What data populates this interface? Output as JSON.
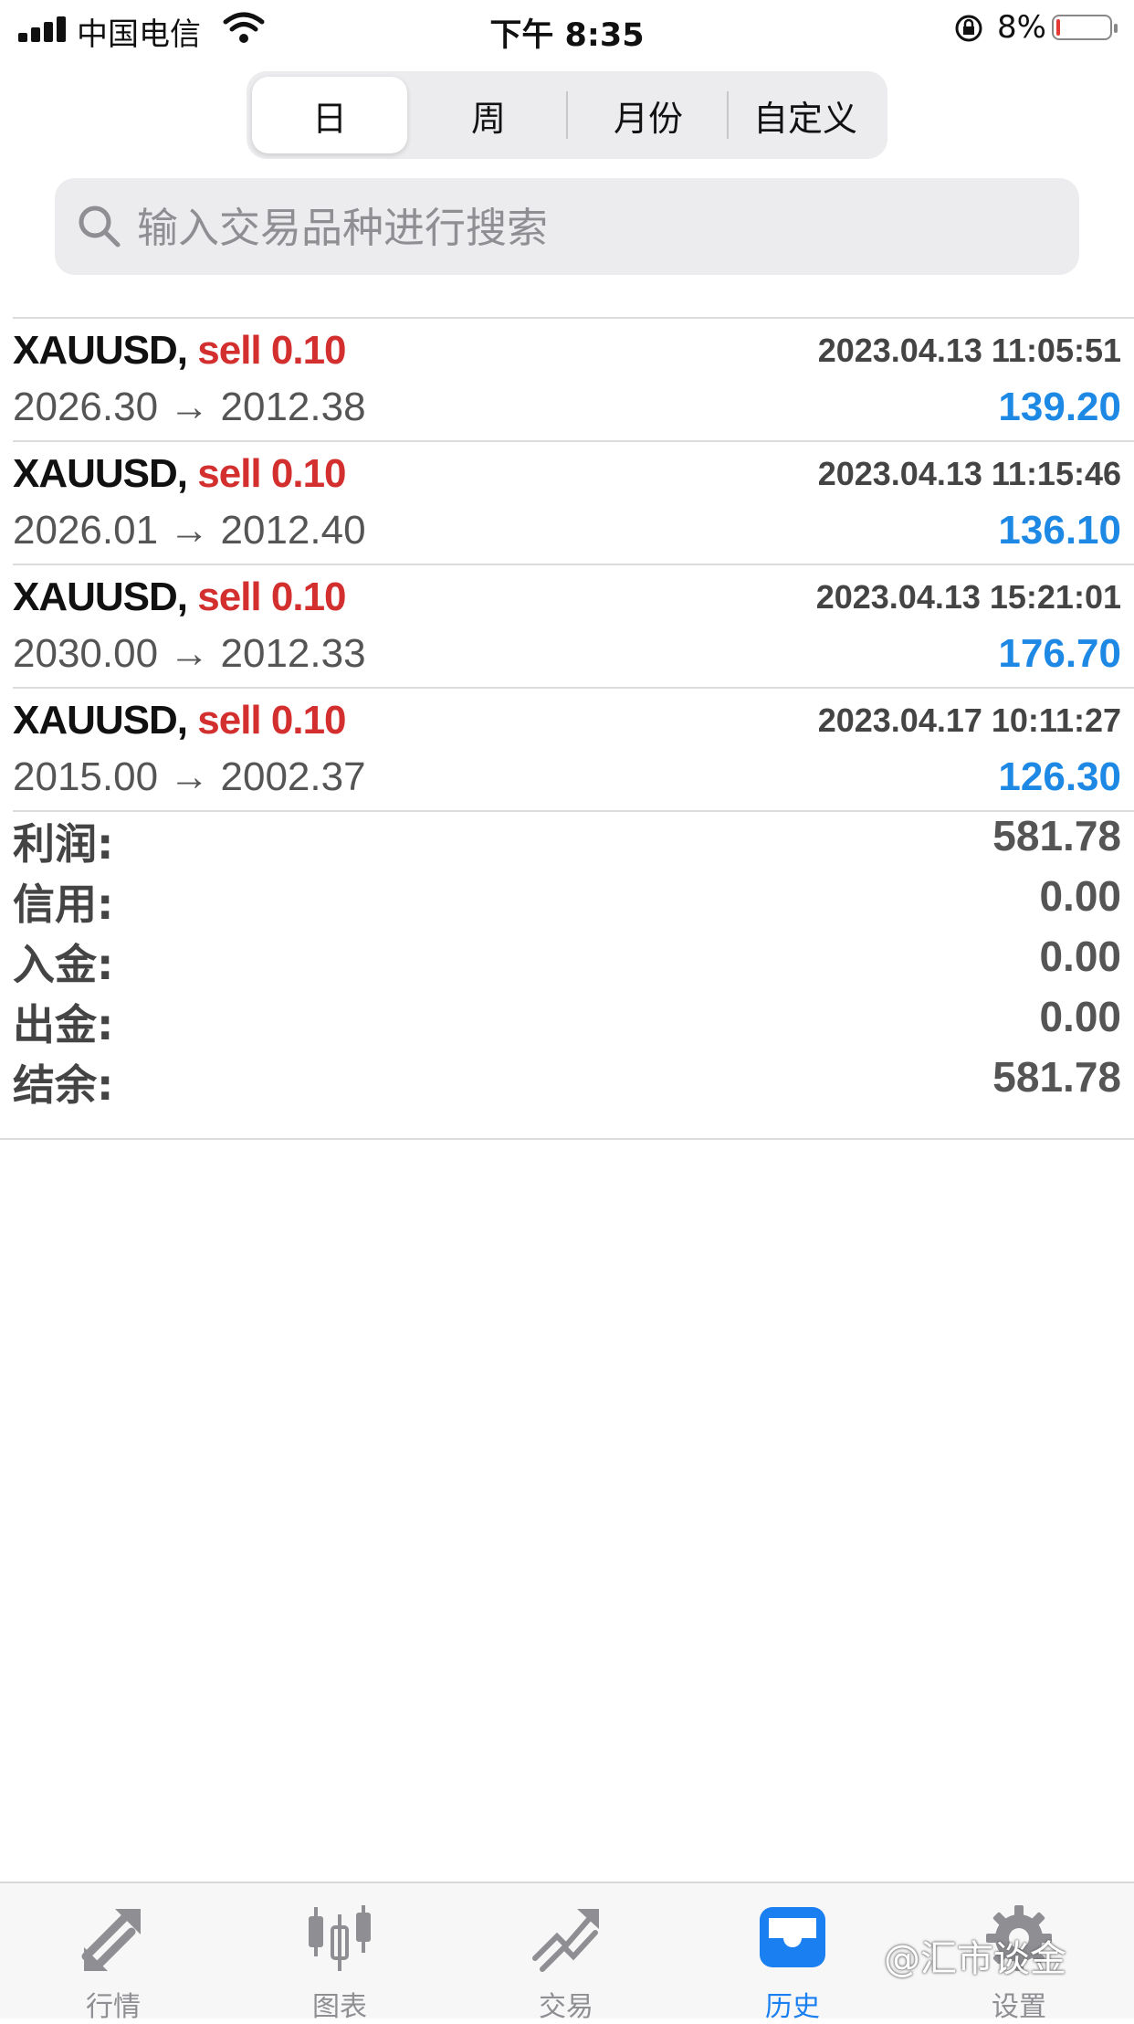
{
  "status_bar": {
    "carrier": "中国电信",
    "time": "下午 8:35",
    "battery": "8%",
    "battery_level": 0.08
  },
  "tabs_period": {
    "items": [
      "日",
      "周",
      "月份",
      "自定义"
    ],
    "active": "日"
  },
  "search": {
    "placeholder": "输入交易品种进行搜索"
  },
  "trades": [
    {
      "symbol": "XAUUSD,",
      "direction": "sell 0.10",
      "time": "2023.04.13 11:05:51",
      "prices": "2026.30 → 2012.38",
      "profit": "139.20"
    },
    {
      "symbol": "XAUUSD,",
      "direction": "sell 0.10",
      "time": "2023.04.13 11:15:46",
      "prices": "2026.01 → 2012.40",
      "profit": "136.10"
    },
    {
      "symbol": "XAUUSD,",
      "direction": "sell 0.10",
      "time": "2023.04.13 15:21:01",
      "prices": "2030.00 → 2012.33",
      "profit": "176.70"
    },
    {
      "symbol": "XAUUSD,",
      "direction": "sell 0.10",
      "time": "2023.04.17 10:11:27",
      "prices": "2015.00 → 2002.37",
      "profit": "126.30"
    }
  ],
  "summary": [
    {
      "label": "利润:",
      "value": "581.78"
    },
    {
      "label": "信用:",
      "value": "0.00"
    },
    {
      "label": "入金:",
      "value": "0.00"
    },
    {
      "label": "出金:",
      "value": "0.00"
    },
    {
      "label": "结余:",
      "value": "581.78"
    }
  ],
  "tabbar": {
    "items": [
      {
        "label": "行情",
        "icon": "quotes-arrows-icon"
      },
      {
        "label": "图表",
        "icon": "candlestick-chart-icon"
      },
      {
        "label": "交易",
        "icon": "trade-trend-icon"
      },
      {
        "label": "历史",
        "icon": "history-inbox-icon"
      },
      {
        "label": "设置",
        "icon": "gear-icon"
      }
    ],
    "active": "历史"
  },
  "watermark": "@汇市谈金",
  "colors": {
    "sell": "#d32f2f",
    "profit": "#1e88e5",
    "active_tab": "#1a7ff0"
  }
}
